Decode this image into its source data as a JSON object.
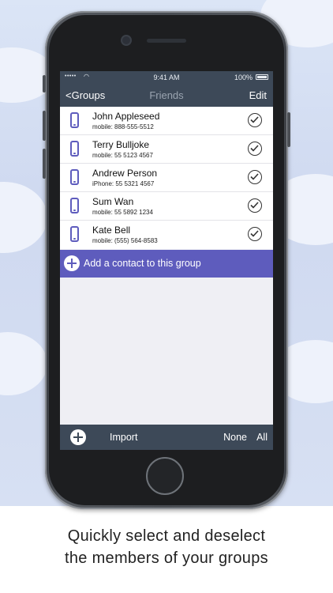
{
  "status_bar": {
    "signal": "•••••",
    "time": "9:41 AM",
    "battery": "100%"
  },
  "nav": {
    "back_label": "<Groups",
    "title": "Friends",
    "edit_label": "Edit"
  },
  "contacts": [
    {
      "name": "John Appleseed",
      "detail": "mobile: 888-555-5512",
      "selected": true
    },
    {
      "name": "Terry Bulljoke",
      "detail": "mobile: 55 5123 4567",
      "selected": true
    },
    {
      "name": "Andrew Person",
      "detail": "iPhone: 55 5321 4567",
      "selected": true
    },
    {
      "name": "Sum Wan",
      "detail": "mobile: 55 5892 1234",
      "selected": true
    },
    {
      "name": "Kate Bell",
      "detail": "mobile: (555) 564-8583",
      "selected": true
    }
  ],
  "add_contact_label": "Add a contact to this group",
  "toolbar": {
    "import_label": "Import",
    "none_label": "None",
    "all_label": "All"
  },
  "caption": {
    "line1": "Quickly select and deselect",
    "line2": "the members of your groups"
  },
  "colors": {
    "accent": "#5e5cbd",
    "bar": "#3d4958",
    "background": "#efeff4"
  }
}
